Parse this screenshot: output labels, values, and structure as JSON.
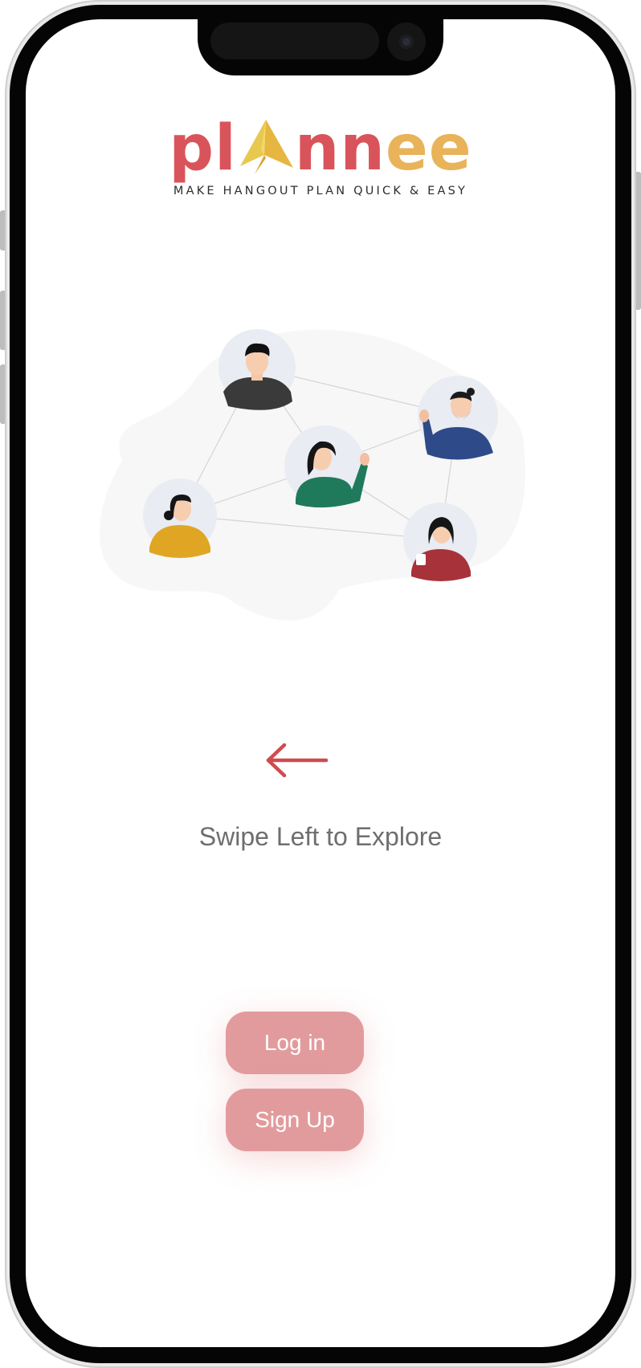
{
  "logo": {
    "part1": "pl",
    "part2": "nn",
    "part3": "ee",
    "tagline": "MAKE HANGOUT PLAN QUICK & EASY"
  },
  "illustration": {
    "people": [
      "person-dark-shirt",
      "person-blue-shirt",
      "person-green-shirt",
      "person-yellow-shirt",
      "person-red-shirt"
    ]
  },
  "instruction": {
    "icon": "arrow-left-icon",
    "text": "Swipe Left to Explore"
  },
  "buttons": {
    "login": "Log in",
    "signup": "Sign Up"
  },
  "colors": {
    "brand": "#d9545a",
    "button": "#e29b9d",
    "arrow": "#cf4b4f"
  }
}
